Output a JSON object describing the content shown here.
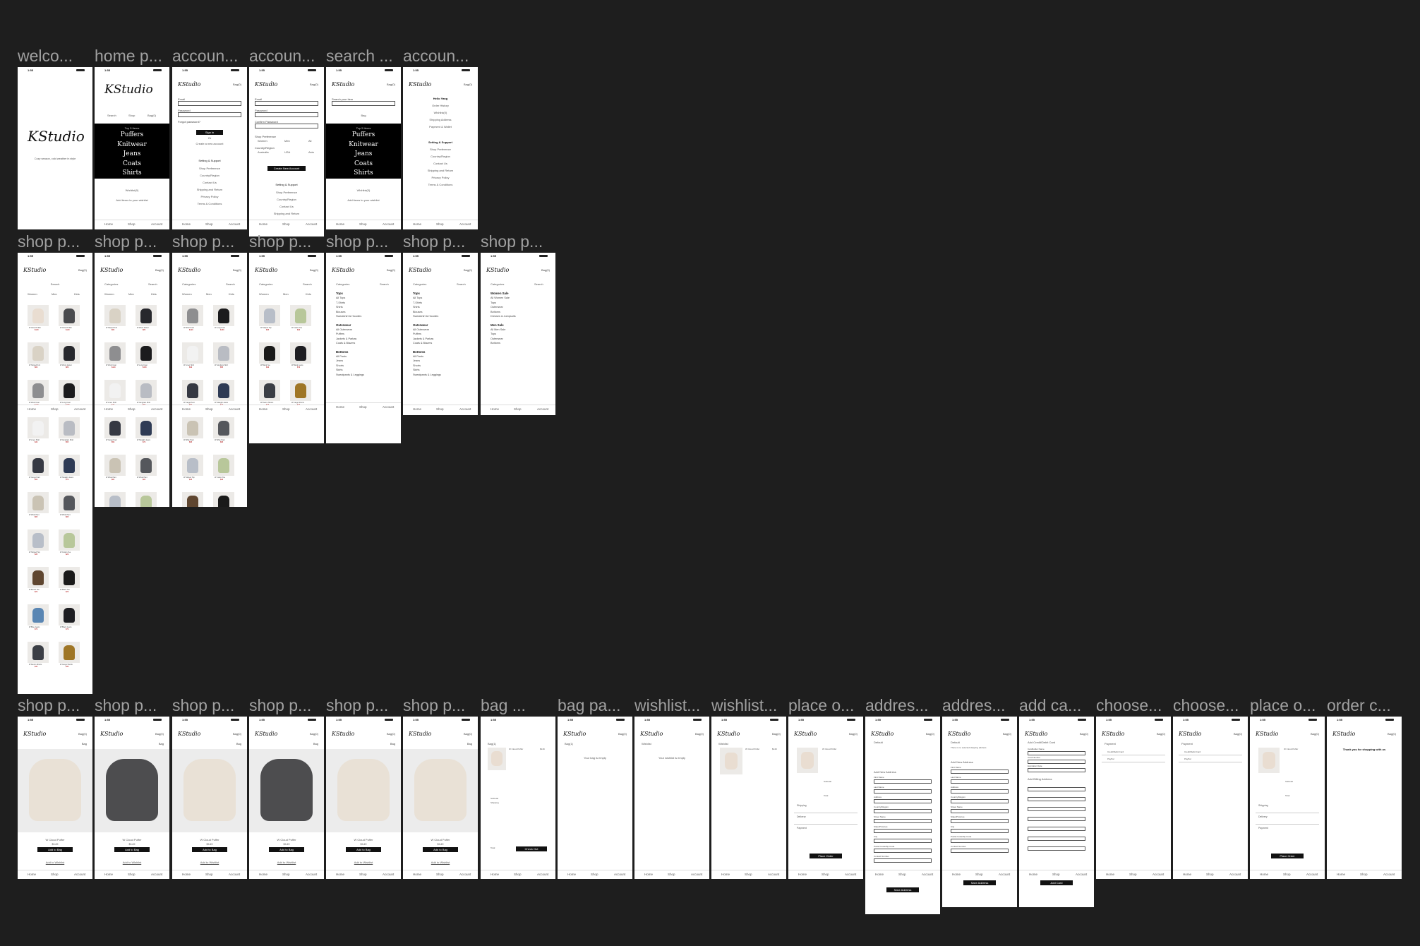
{
  "canvas": {
    "background": "#1e1e1e",
    "title_color": "#a0a0a0"
  },
  "brand": {
    "logo": "KStudio",
    "tagline": "Cozy season, cold weather in style"
  },
  "status": {
    "time": "1:55"
  },
  "header": {
    "bag": "Bag(0)",
    "bag_short": "Bag"
  },
  "tabs": {
    "home": "Home",
    "shop": "Shop",
    "account": "Account"
  },
  "frame_titles": {
    "row1": [
      "welco...",
      "home p...",
      "accoun...",
      "accoun...",
      "search ...",
      "accoun..."
    ],
    "row2": [
      "shop p...",
      "shop p...",
      "shop p...",
      "shop p...",
      "shop p...",
      "shop p...",
      "shop p..."
    ],
    "row3": [
      "shop p...",
      "shop p...",
      "shop p...",
      "shop p...",
      "shop p...",
      "shop p...",
      "bag ...",
      "bag pa...",
      "wishlist...",
      "wishlist...",
      "place o...",
      "addres...",
      "addres...",
      "add ca...",
      "choose...",
      "choose...",
      "place o...",
      "order c..."
    ]
  },
  "home": {
    "links": [
      "Search",
      "Shop",
      "Bag(0)"
    ],
    "top_label": "Top 5 Items",
    "categories": [
      "Puffers",
      "Knitwear",
      "Jeans",
      "Coats",
      "Shirts"
    ],
    "wishlist": "Wishlist(0)",
    "wishlist_note": "Add items to your wishlist"
  },
  "signin": {
    "fields": [
      "Email",
      "Password"
    ],
    "forgot": "Forgot password?",
    "sign_in_button": "Sign in",
    "or": "Or",
    "create": "Create a new account",
    "settings_title": "Setting & Support",
    "settings": [
      "Shop Preference",
      "Country/Region",
      "Contact Us",
      "Shipping and Return",
      "Privacy Policy",
      "Terms & Conditions"
    ]
  },
  "create": {
    "fields": [
      "Email",
      "Password",
      "Confirm Password"
    ],
    "shop_pref": "Shop Preference",
    "prefs": [
      "Women",
      "Men",
      "All"
    ],
    "country": "Country/Region",
    "countries": [
      "Australia",
      "USA",
      "Asia"
    ],
    "button": "Create New Account",
    "settings_title": "Setting & Support",
    "settings": [
      "Shop Preference",
      "Country/Region",
      "Contact Us",
      "Shipping and Return"
    ]
  },
  "search": {
    "placeholder": "Search your item",
    "or": "Bag"
  },
  "account": {
    "hello": "Hello Yang",
    "items": [
      "Order History",
      "Wishlist(0)",
      "Shipping Address",
      "Payment & Wallet"
    ],
    "settings_title": "Setting & Support",
    "settings": [
      "Shop Preference",
      "Country/Region",
      "Contact Us",
      "Shipping and Return",
      "Privacy Policy",
      "Terms & Conditions"
    ]
  },
  "shop": {
    "tabs": [
      "Women",
      "Men",
      "Kids"
    ],
    "topbar": [
      "Categories",
      "Search"
    ],
    "products": [
      {
        "name": "W Cloud Puffer",
        "price": "$149",
        "color": "#e9ddd1"
      },
      {
        "name": "W Cloud Puffer",
        "price": "$149",
        "color": "#4a4b4e"
      },
      {
        "name": "W Striped Knit",
        "price": "$69",
        "color": "#d9d2c5"
      },
      {
        "name": "W Wool Jacket",
        "price": "$89",
        "color": "#27282d"
      },
      {
        "name": "W Wool Coat",
        "price": "$129",
        "color": "#8e8e90"
      },
      {
        "name": "W Long Coat",
        "price": "$159",
        "color": "#1b1b1d"
      },
      {
        "name": "W Linen Shirt",
        "price": "$49",
        "color": "#f2f2f2"
      },
      {
        "name": "W Gingham Shirt",
        "price": "$55",
        "color": "#b9bcc3"
      },
      {
        "name": "W Cargo Pant",
        "price": "$59",
        "color": "#363943"
      },
      {
        "name": "W Straight Jeans",
        "price": "$79",
        "color": "#2f3b55"
      },
      {
        "name": "W Wide Pant",
        "price": "$65",
        "color": "#cac3b4"
      },
      {
        "name": "W Wide Pant",
        "price": "$65",
        "color": "#55575c"
      },
      {
        "name": "W Striped Top",
        "price": "$35",
        "color": "#b8bec8"
      },
      {
        "name": "W Cotton Tee",
        "price": "$29",
        "color": "#b8c79a"
      },
      {
        "name": "W Brown Tee",
        "price": "$29",
        "color": "#5f4630"
      },
      {
        "name": "W Black Tee",
        "price": "$29",
        "color": "#1a1a1a"
      },
      {
        "name": "W Blue Jeans",
        "price": "$79",
        "color": "#5a86b3"
      },
      {
        "name": "W Black Jeans",
        "price": "$79",
        "color": "#1e1e22"
      },
      {
        "name": "W Denim Shorts",
        "price": "$45",
        "color": "#3b3e45"
      },
      {
        "name": "W Cargo Shorts",
        "price": "$45",
        "color": "#9f7626"
      }
    ],
    "categories": {
      "tops_title": "Tops",
      "tops": [
        "All Tops",
        "T-Shirts",
        "Shirts",
        "Blouses",
        "Sweatshirt & Hoodies"
      ],
      "outer_title": "Outerwear",
      "outer": [
        "All Outerwear",
        "Puffers",
        "Jackets & Parkas",
        "Coats & Blazers"
      ],
      "bottoms_title": "Bottoms",
      "bottoms": [
        "All Pants",
        "Jeans",
        "Shorts",
        "Skirts",
        "Sweatpants & Leggings"
      ],
      "sale_title": "Women Sale",
      "sale": [
        "All Women Sale",
        "Tops",
        "Outerwear",
        "Bottoms",
        "Dresses & Jumpsuits"
      ],
      "men_sale_title": "Men Sale",
      "men_sale": [
        "All Men Sale",
        "Tops",
        "Outerwear",
        "Bottoms"
      ]
    }
  },
  "detail": {
    "name": "W Cloud Puffer",
    "price": "$149",
    "add_bag": "Add to Bag",
    "add_wish": "Add to Wishlist",
    "colors": [
      "#e9e1d6",
      "#4d4d4f",
      "#e9e1d6",
      "#4d4d4f",
      "#e9e1d6",
      "#e9e1d6"
    ]
  },
  "bag": {
    "title": "Bag(1)",
    "subtotal": "Subtotal",
    "shipping": "Shipping",
    "total": "Total",
    "checkout": "Check Out",
    "empty": "Your bag is empty"
  },
  "wishlist": {
    "empty": "Your wishlist is empty",
    "title": "Wishlist"
  },
  "order": {
    "shipping": "Shipping",
    "delivery": "Delivery",
    "payment": "Payment",
    "place_order": "Place Order"
  },
  "address": {
    "default": "Default",
    "add_title": "Add New Address",
    "fields": [
      "First Name",
      "Last Name",
      "Address",
      "Country/Region",
      "Street Name",
      "State/Province",
      "City",
      "Postal Code/Zip Code",
      "Contact Number"
    ],
    "save": "Save Address",
    "none": "There is no selected shipping address"
  },
  "card": {
    "add_title": "Add Credit/Debit Card",
    "fields": [
      "Cardholder Name",
      "Card Number",
      "Expiration Date"
    ],
    "billing": "Add Billing Address",
    "button": "Add Card"
  },
  "choose": {
    "payment": "Payment",
    "card_label": "Credit/Debit Card",
    "paypal": "PayPal"
  },
  "confirm": {
    "title": "Thank you for shopping with us"
  }
}
